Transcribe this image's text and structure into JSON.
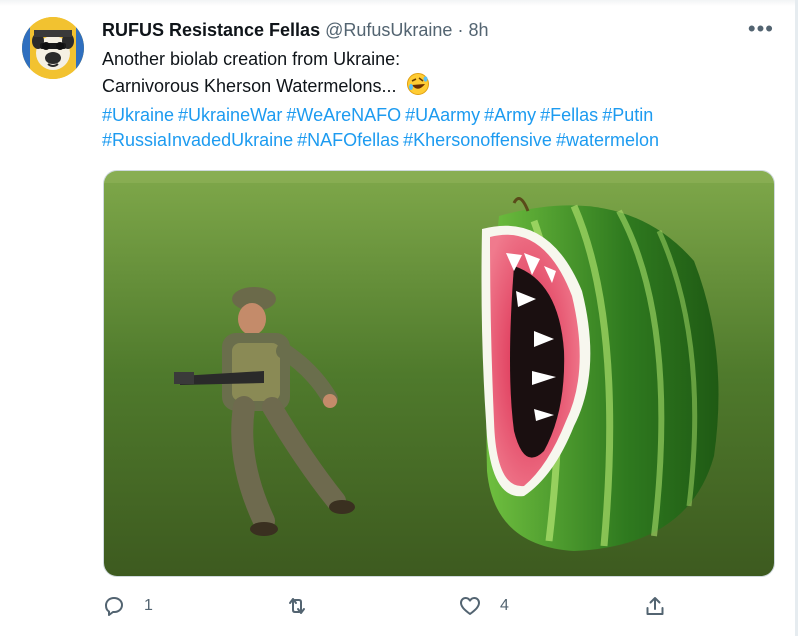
{
  "tweet": {
    "author_name": "RUFUS Resistance Fellas",
    "handle": "@RufusUkraine",
    "separator": "·",
    "time": "8h",
    "text_line1": "Another biolab creation from Ukraine:",
    "text_line2": "Carnivorous Kherson Watermelons...",
    "emoji_icon": "rolling-on-floor-laughing-emoji",
    "hashtags_row1": [
      "#Ukraine",
      "#UkraineWar",
      "#WeAreNAFO",
      "#UAarmy",
      "#Army",
      "#Fellas",
      "#Putin"
    ],
    "hashtags_row2": [
      "#RussiaInvadedUkraine",
      "#NAFOfellas",
      "#Khersonoffensive",
      "#watermelon"
    ]
  },
  "actions": {
    "reply_icon": "reply-icon",
    "reply_count": "1",
    "retweet_icon": "retweet-icon",
    "like_icon": "heart-icon",
    "like_count": "4",
    "share_icon": "share-icon"
  },
  "colors": {
    "link": "#1d9bf0",
    "muted": "#536471",
    "text": "#0f1419"
  }
}
